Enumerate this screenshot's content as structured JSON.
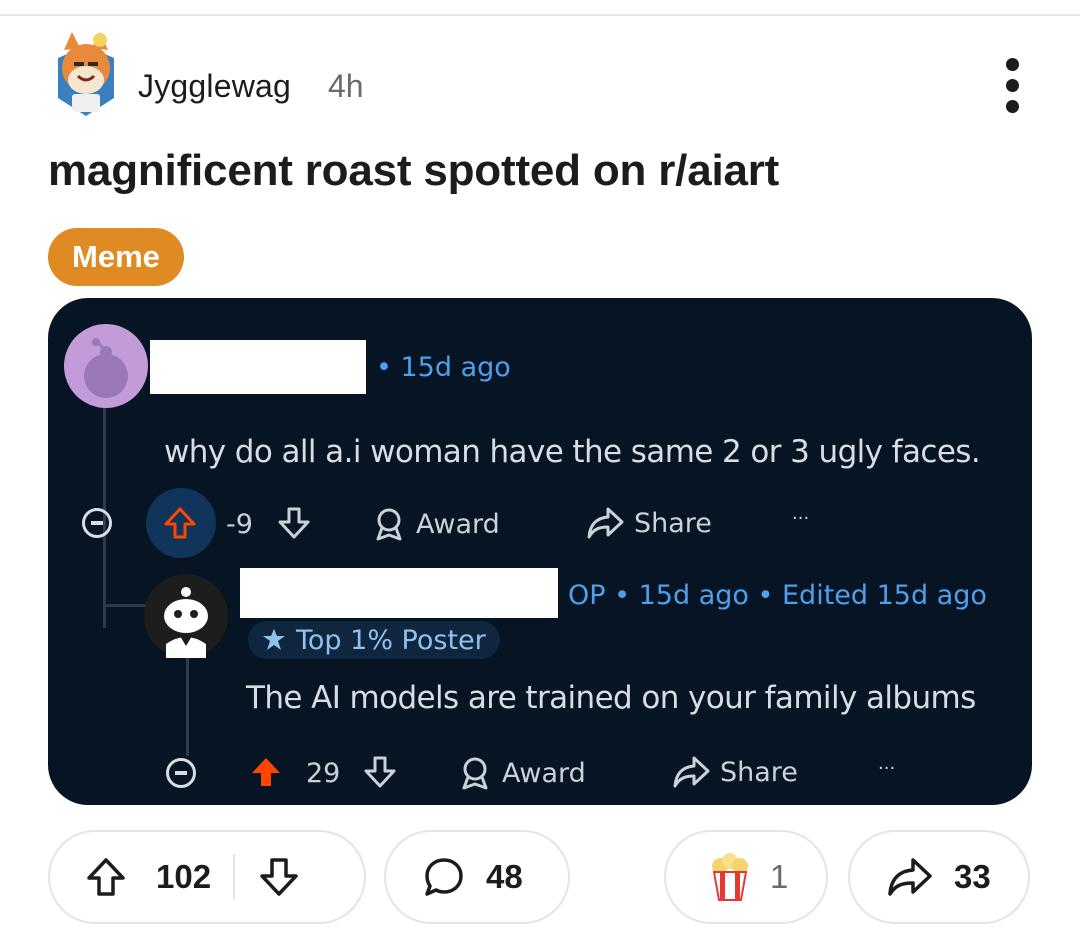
{
  "post": {
    "author": "Jygglewag",
    "age": "4h",
    "title": "magnificent roast spotted on r/aiart",
    "flair": "Meme",
    "colors": {
      "flair": "#e08a23",
      "embed_bg": "#071424",
      "upvote_active": "#ff4500"
    }
  },
  "embed": {
    "comment1": {
      "meta": "• 15d ago",
      "body": "why do all a.i woman have the same 2 or 3 ugly faces.",
      "score": "-9",
      "award_label": "Award",
      "share_label": "Share",
      "more": "···"
    },
    "comment2": {
      "meta": "OP • 15d ago • Edited 15d ago",
      "badge": "Top 1% Poster",
      "body": "The AI models are trained on your family albums",
      "score": "29",
      "award_label": "Award",
      "share_label": "Share",
      "more": "···"
    }
  },
  "actions": {
    "upvotes": "102",
    "comments": "48",
    "awards": "1",
    "shares": "33"
  },
  "icons": [
    "snoo-avatar-icon",
    "more-vertical-icon",
    "upvote-icon",
    "downvote-icon",
    "award-icon",
    "share-icon",
    "collapse-icon",
    "comment-icon",
    "popcorn-award-icon"
  ]
}
